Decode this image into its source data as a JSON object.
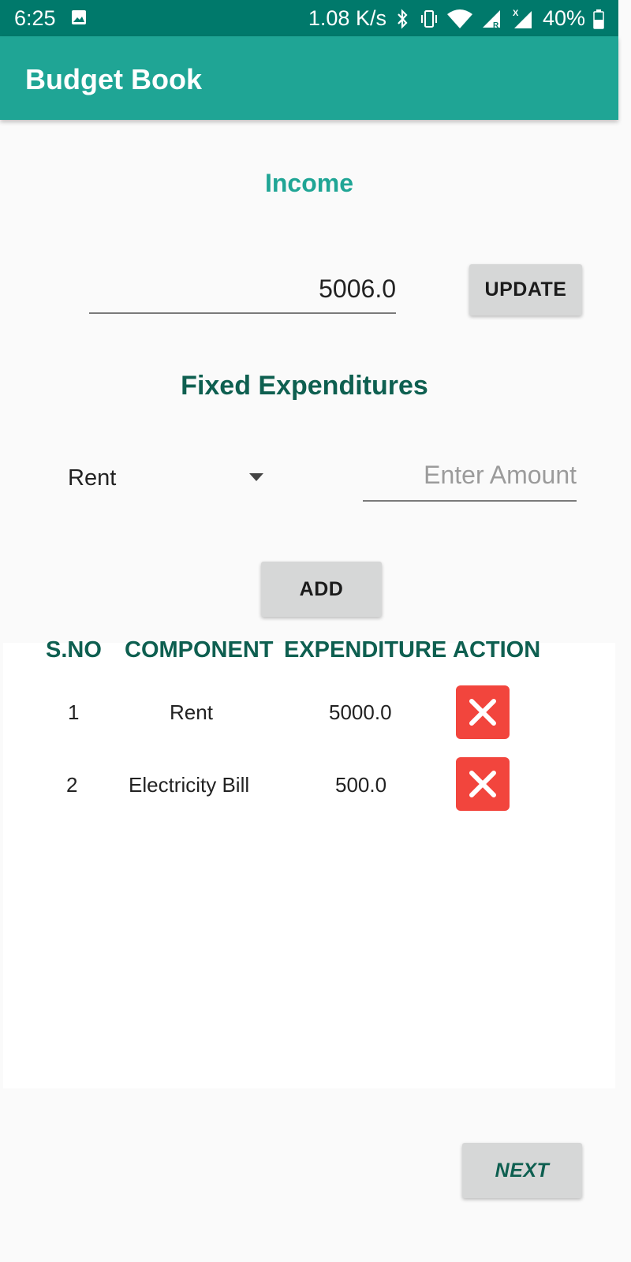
{
  "status_bar": {
    "time": "6:25",
    "net_speed": "1.08 K/s",
    "roaming_mark": "R",
    "data_mark": "X",
    "battery": "40%"
  },
  "app": {
    "title": "Budget Book",
    "accent": "#1fa595",
    "dark_accent": "#0e5f50"
  },
  "income": {
    "label": "Income",
    "value": "5006.0",
    "update_label": "UPDATE"
  },
  "fixed": {
    "label": "Fixed Expenditures",
    "selected_component": "Rent",
    "amount_placeholder": "Enter Amount",
    "add_label": "ADD"
  },
  "table": {
    "headers": [
      "S.NO",
      "COMPONENT",
      "EXPENDITURE",
      "ACTION"
    ],
    "rows": [
      {
        "sno": "1",
        "component": "Rent",
        "expenditure": "5000.0"
      },
      {
        "sno": "2",
        "component": "Electricity Bill",
        "expenditure": "500.0"
      }
    ],
    "delete_color": "#f2453d"
  },
  "footer": {
    "next_label": "NEXT"
  }
}
